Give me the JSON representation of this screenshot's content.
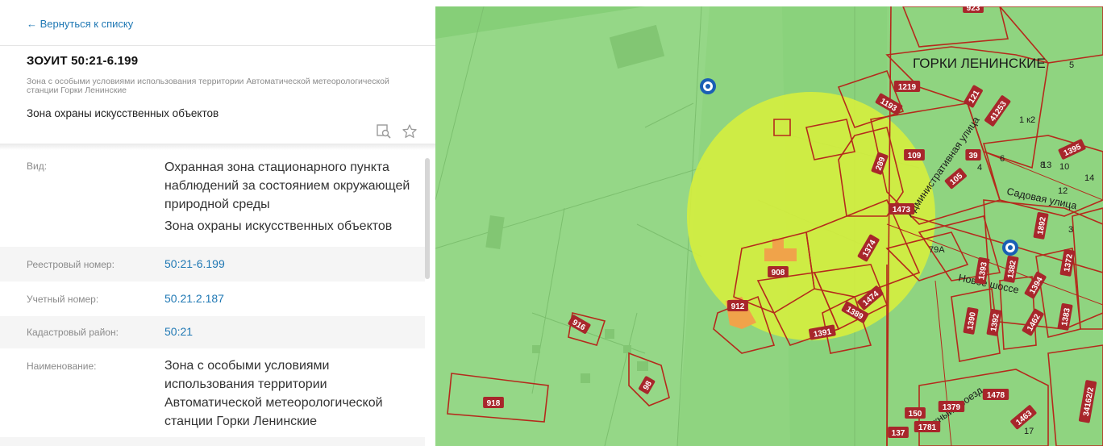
{
  "panel": {
    "back_label": "← Вернуться к списку",
    "title": "ЗОУИТ 50:21-6.199",
    "subtitle": "Зона с особыми условиями использования территории Автоматической метеорологической станции Горки Ленинские",
    "zone_type": "Зона охраны искусственных объектов",
    "details": {
      "kind_label": "Вид:",
      "kind_value_1": "Охранная зона стационарного пункта наблюдений за состоянием окружающей природной среды",
      "kind_value_2": "Зона охраны искусственных объектов",
      "reg_label": "Реестровый номер:",
      "reg_value": "50:21-6.199",
      "acc_label": "Учетный номер:",
      "acc_value": "50.21.2.187",
      "district_label": "Кадастровый район:",
      "district_value": "50:21",
      "name_label": "Наименование:",
      "name_value": "Зона с особыми условиями использования территории Автоматической метеорологической станции Горки Ленинские"
    }
  },
  "map": {
    "place_label": "ГОРКИ ЛЕНИНСКИЕ",
    "streets": {
      "admin": "Административная улица",
      "sad": "Садовая улица",
      "shosse": "Новое шоссе",
      "yuzh": "Южный проезд"
    },
    "parcels": [
      "923",
      "1219",
      "121",
      "41253",
      "1193",
      "109",
      "39",
      "1395",
      "289",
      "105",
      "1473",
      "1374",
      "908",
      "1474",
      "912",
      "1389",
      "1391",
      "916",
      "98",
      "918",
      "1393",
      "1382",
      "1372",
      "1892",
      "1394",
      "1390",
      "1392",
      "1462",
      "1383",
      "1478",
      "1379",
      "1463",
      "34162/2",
      "1781",
      "150",
      "137"
    ],
    "house_numbers": [
      "5",
      "1 к2",
      "4",
      "6",
      "8",
      "10",
      "14",
      "12",
      "3",
      "79А",
      "13",
      "17"
    ],
    "colors": {
      "zone_circle": "#d7ef3c",
      "parcel_border": "#b52a1c",
      "label_bg": "#a8262b",
      "map_green": "#8fd480"
    }
  }
}
